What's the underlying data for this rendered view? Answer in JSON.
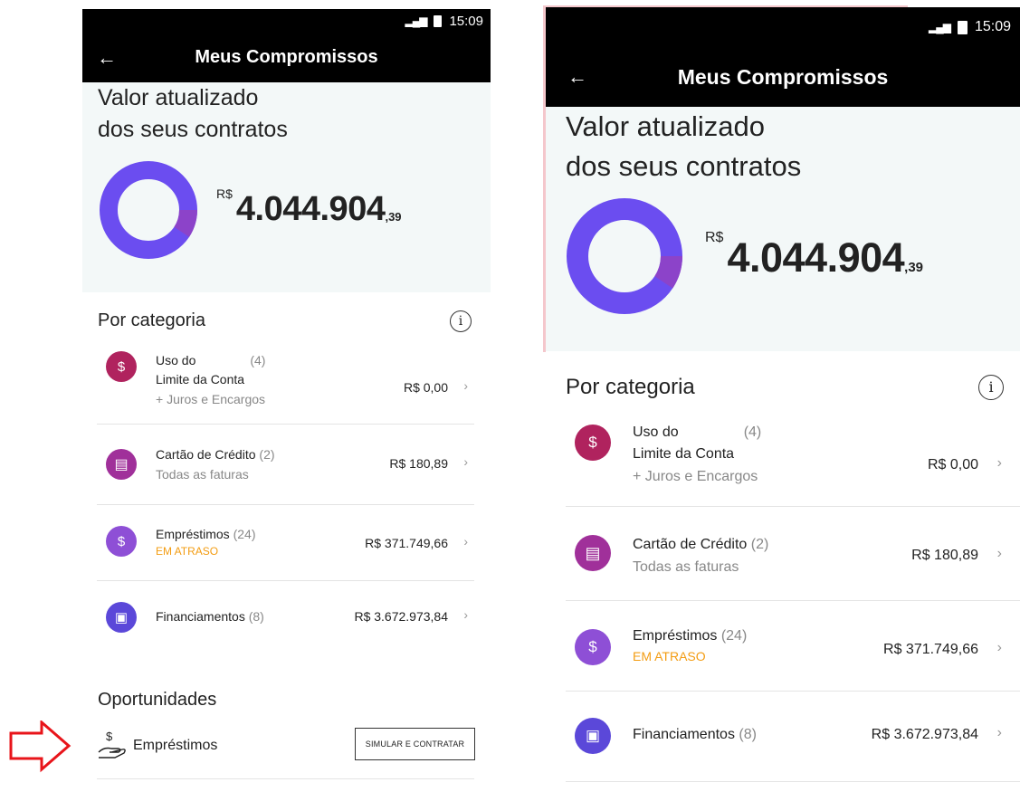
{
  "status": {
    "time": "15:09",
    "signal": "LTE"
  },
  "appbar": {
    "title": "Meus Compromissos",
    "back_icon": "arrow-left-icon"
  },
  "hero": {
    "label_line1": "Valor atualizado",
    "label_line2": "dos seus contratos",
    "currency": "R$",
    "amount_main": "4.044.904",
    "amount_cents": ",39"
  },
  "categories": {
    "title": "Por categoria",
    "info_icon": "i",
    "items": [
      {
        "icon": "overdraft-icon",
        "name": "Uso do",
        "count": "(4)",
        "name2": "Limite da Conta",
        "sub": "+ Juros e Encargos",
        "value": "R$ 0,00",
        "color": "#b0235e"
      },
      {
        "icon": "card-icon",
        "name": "Cartão de Crédito",
        "count": "(2)",
        "sub": "Todas as faturas",
        "value": "R$ 180,89",
        "color": "#a0309a"
      },
      {
        "icon": "loan-icon",
        "name": "Empréstimos",
        "count": "(24)",
        "late": "EM ATRASO",
        "value": "R$ 371.749,66",
        "color": "#8e4fd6"
      },
      {
        "icon": "financing-icon",
        "name": "Financiamentos",
        "count": "(8)",
        "value": "R$ 3.672.973,84",
        "color": "#5b48d9"
      }
    ]
  },
  "opportunities": {
    "title": "Oportunidades",
    "item_label": "Empréstimos",
    "button_label": "SIMULAR E CONTRATAR"
  },
  "colors": {
    "donut_main": "#6b4df0",
    "donut_accent": "#8c43c9",
    "late": "#f39c12",
    "annotation": "#e8141a"
  }
}
